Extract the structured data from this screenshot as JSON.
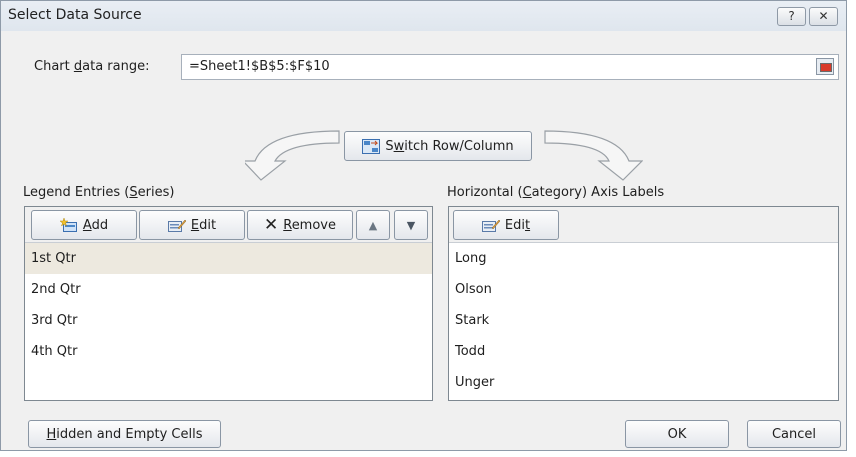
{
  "window": {
    "title": "Select Data Source",
    "help_glyph": "?",
    "close_glyph": "✕"
  },
  "data_range": {
    "label_pre": "Chart ",
    "label_u": "d",
    "label_post": "ata range:",
    "value": "=Sheet1!$B$5:$F$10"
  },
  "switch": {
    "label_pre": "S",
    "label_u": "w",
    "label_post": "itch Row/Column"
  },
  "legend": {
    "title_pre": "Legend Entries (",
    "title_u": "S",
    "title_post": "eries)",
    "add_u": "A",
    "add_post": "dd",
    "edit_u": "E",
    "edit_post": "dit",
    "remove_u": "R",
    "remove_post": "emove",
    "items": [
      {
        "label": "1st Qtr"
      },
      {
        "label": "2nd Qtr"
      },
      {
        "label": "3rd Qtr"
      },
      {
        "label": "4th Qtr"
      }
    ]
  },
  "axis": {
    "title_pre": "Horizontal (",
    "title_u": "C",
    "title_post": "ategory) Axis Labels",
    "edit_pre": "Edi",
    "edit_u": "t",
    "items": [
      {
        "label": "Long"
      },
      {
        "label": "Olson"
      },
      {
        "label": "Stark"
      },
      {
        "label": "Todd"
      },
      {
        "label": "Unger"
      }
    ]
  },
  "footer": {
    "hidden_u": "H",
    "hidden_post": "idden and Empty Cells",
    "ok_label": "OK",
    "cancel_label": "Cancel"
  },
  "colors": {
    "selected_row": "#ede9df",
    "dialog_bg": "#f0f0f0"
  }
}
